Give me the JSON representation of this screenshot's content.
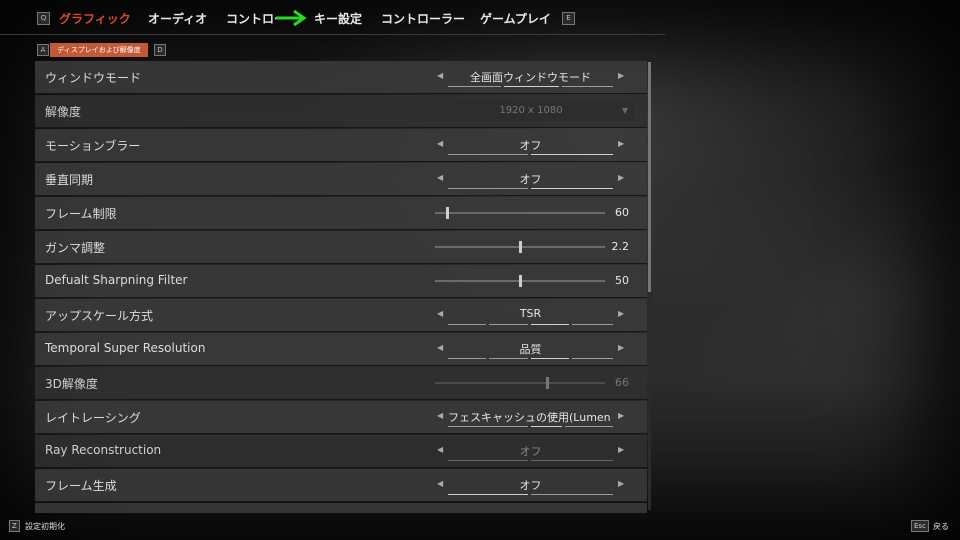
{
  "nav": {
    "prev_key": "Q",
    "next_key": "E",
    "tabs": [
      {
        "label": "グラフィック",
        "active": true
      },
      {
        "label": "オーディオ"
      },
      {
        "label": "コントロー"
      },
      {
        "label": "キー設定"
      },
      {
        "label": "コントローラー"
      },
      {
        "label": "ゲームプレイ"
      }
    ]
  },
  "subnav": {
    "prev_key": "A",
    "next_key": "D",
    "active_label": "ディスプレイおよび解像度"
  },
  "settings": [
    {
      "label": "ウィンドウモード",
      "type": "selector",
      "value": "全画面ウィンドウモード"
    },
    {
      "label": "解像度",
      "type": "dropdown",
      "value": "1920 x 1080",
      "disabled": true
    },
    {
      "label": "モーションブラー",
      "type": "selector",
      "value": "オフ"
    },
    {
      "label": "垂直同期",
      "type": "selector",
      "value": "オフ"
    },
    {
      "label": "フレーム制限",
      "type": "slider",
      "value": "60",
      "fraction": 0.07
    },
    {
      "label": "ガンマ調整",
      "type": "slider",
      "value": "2.2",
      "fraction": 0.5
    },
    {
      "label": "Defualt Sharpning Filter",
      "type": "slider",
      "value": "50",
      "fraction": 0.5
    },
    {
      "label": "アップスケール方式",
      "type": "selector",
      "value": "TSR"
    },
    {
      "label": "Temporal Super Resolution",
      "type": "selector",
      "value": "品質"
    },
    {
      "label": "3D解像度",
      "type": "slider",
      "value": "66",
      "fraction": 0.66,
      "disabled": true
    },
    {
      "label": "レイトレーシング",
      "type": "selector",
      "value": "フェスキャッシュの使用(Lumen I"
    },
    {
      "label": "Ray Reconstruction",
      "type": "selector",
      "value": "オフ",
      "disabled": true
    },
    {
      "label": "フレーム生成",
      "type": "selector",
      "value": "オフ"
    }
  ],
  "footer": {
    "reset_key": "Z",
    "reset_label": "設定初期化",
    "back_key": "Esc",
    "back_label": "戻る"
  },
  "colors": {
    "accent": "#e0452e",
    "subtab_bg": "#c45a35",
    "annotation_arrow": "#22dd22"
  }
}
